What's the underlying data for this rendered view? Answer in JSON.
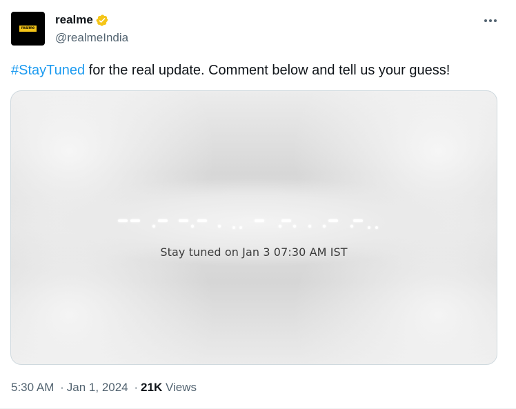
{
  "author": {
    "name": "realme",
    "handle": "@realmeIndia",
    "avatar_logo_text": "realme",
    "verified": true,
    "verified_color": "#f5c518"
  },
  "tweet": {
    "hashtag": "#StayTuned",
    "text": " for the real update. Comment below and tell us your guess!"
  },
  "media": {
    "caption": "Stay tuned on Jan 3 07:30 AM IST"
  },
  "meta": {
    "time": "5:30 AM",
    "separator": "·",
    "date": "Jan 1, 2024",
    "views_count": "21K",
    "views_label": "Views"
  },
  "icons": {
    "more": "more-horizontal-icon",
    "verified": "verified-badge-icon"
  },
  "colors": {
    "accent": "#1d9bf0",
    "text": "#0f1419",
    "secondary": "#536471"
  }
}
